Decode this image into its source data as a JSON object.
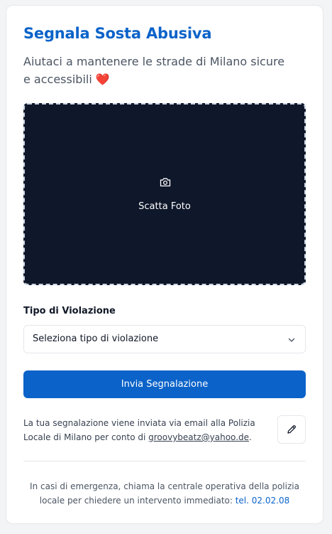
{
  "header": {
    "title": "Segnala Sosta Abusiva",
    "subtitle": "Aiutaci a mantenere le strade di Milano sicure e accessibili",
    "subtitle_emoji": "❤️"
  },
  "photo": {
    "icon": "camera-icon",
    "label": "Scatta Foto"
  },
  "violation": {
    "label": "Tipo di Violazione",
    "selected": "Seleziona tipo di violazione"
  },
  "submit_label": "Invia Segnalazione",
  "notice": {
    "text_before": "La tua segnalazione viene inviata via email alla Polizia Locale di Milano per conto di ",
    "email": "groovybeatz@yahoo.de",
    "text_after": ".",
    "edit_icon": "pencil-icon"
  },
  "footer": {
    "text": "In casi di emergenza, chiama la centrale operativa della polizia locale per chiedere un intervento immediato: ",
    "phone": "tel. 02.02.08"
  },
  "colors": {
    "accent": "#0b63c9",
    "camera_bg": "#0f172a",
    "heart": "#e11d2e"
  }
}
